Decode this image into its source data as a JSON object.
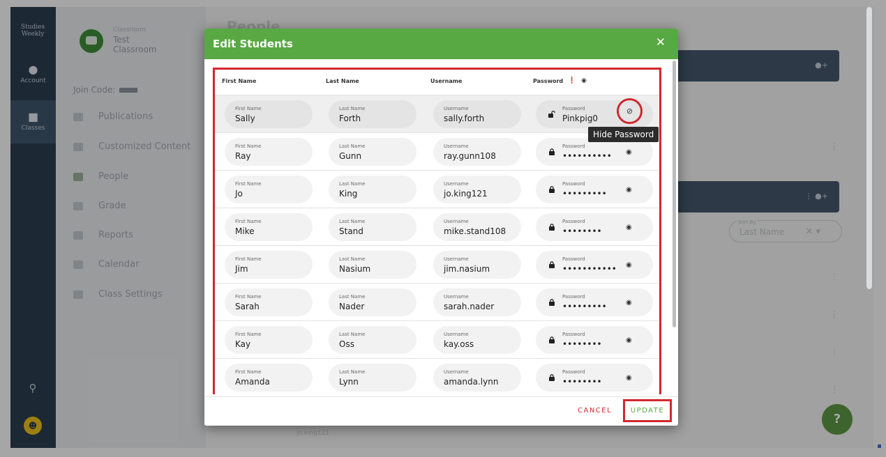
{
  "app": {
    "logo_text": "Studies Weekly",
    "rail": {
      "account_label": "Account",
      "classes_label": "Classes"
    },
    "sidebar": {
      "class_small_label": "Classroom",
      "class_name_line1": "Test",
      "class_name_line2": "Classroom",
      "join_code_label": "Join Code:",
      "nav_items": [
        {
          "label": "Publications"
        },
        {
          "label": "Customized Content"
        },
        {
          "label": "People"
        },
        {
          "label": "Grade"
        },
        {
          "label": "Reports"
        },
        {
          "label": "Calendar"
        },
        {
          "label": "Class Settings"
        }
      ]
    },
    "main": {
      "page_title": "People",
      "sort_label": "Sort By",
      "sort_value": "Last Name",
      "help_label": "?",
      "bg_username": "jo.king121"
    }
  },
  "dialog": {
    "title": "Edit Students",
    "columns": {
      "first_name": "First Name",
      "last_name": "Last Name",
      "username": "Username",
      "password": "Password"
    },
    "field_labels": {
      "first_name": "First Name",
      "last_name": "Last Name",
      "username": "Username",
      "password": "Password"
    },
    "students": [
      {
        "first": "Sally",
        "last": "Forth",
        "username": "sally.forth",
        "password": "Pinkpig0"
      },
      {
        "first": "Ray",
        "last": "Gunn",
        "username": "ray.gunn108",
        "password": "••••••••••"
      },
      {
        "first": "Jo",
        "last": "King",
        "username": "jo.king121",
        "password": "•••••••••"
      },
      {
        "first": "Mike",
        "last": "Stand",
        "username": "mike.stand108",
        "password": "••••••••"
      },
      {
        "first": "Jim",
        "last": "Nasium",
        "username": "jim.nasium",
        "password": "•••••••••••"
      },
      {
        "first": "Sarah",
        "last": "Nader",
        "username": "sarah.nader",
        "password": "•••••••••"
      },
      {
        "first": "Kay",
        "last": "Oss",
        "username": "kay.oss",
        "password": "••••••••"
      },
      {
        "first": "Amanda",
        "last": "Lynn",
        "username": "amanda.lynn",
        "password": "••••••••"
      }
    ],
    "tooltip": "Hide Password",
    "cancel_label": "CANCEL",
    "update_label": "UPDATE"
  },
  "colors": {
    "header_green": "#58a943",
    "annotation_red": "#d0282d",
    "rail_navy": "#2c3e50"
  },
  "icons": {
    "close": "close-icon",
    "lock_closed": "lock-icon",
    "lock_open": "unlock-icon",
    "eye": "eye-icon",
    "eye_slash": "eye-slash-icon",
    "info": "info-icon"
  }
}
